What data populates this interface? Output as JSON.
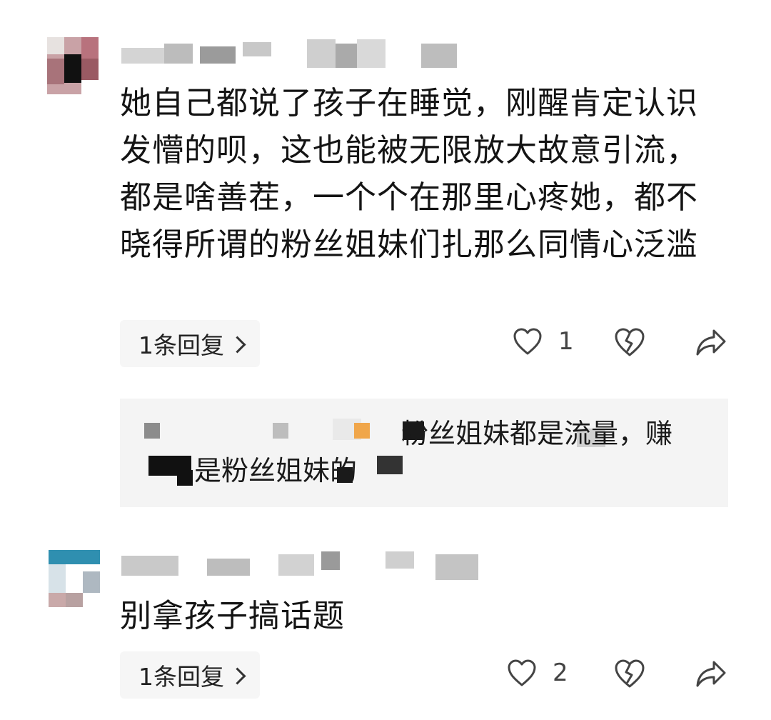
{
  "comments": [
    {
      "text": "她自己都说了孩子在睡觉，刚醒肯定认识发懵的呗，这也能被无限放大故意引流，都是啥善茬，一个个在那里心疼她，都不晓得所谓的粉丝姐妹们扎那么同情心泛滥",
      "reply_label": "1条回复",
      "like_count": "1",
      "icons": [
        "heart-outline-icon",
        "broken-heart-icon",
        "share-arrow-icon"
      ]
    },
    {
      "text": "别拿孩子搞话题",
      "reply_label": "1条回复",
      "like_count": "2",
      "icons": [
        "heart-outline-icon",
        "broken-heart-icon",
        "share-arrow-icon"
      ]
    }
  ],
  "reply_preview": {
    "line1": "粉丝姐妹都是流量，赚",
    "line2": "是粉丝姐妹的"
  },
  "colors": {
    "reply_bg": "#f4f4f4",
    "text": "#141414",
    "icon": "#444444",
    "mosaic_orange": "#f0a64a"
  }
}
